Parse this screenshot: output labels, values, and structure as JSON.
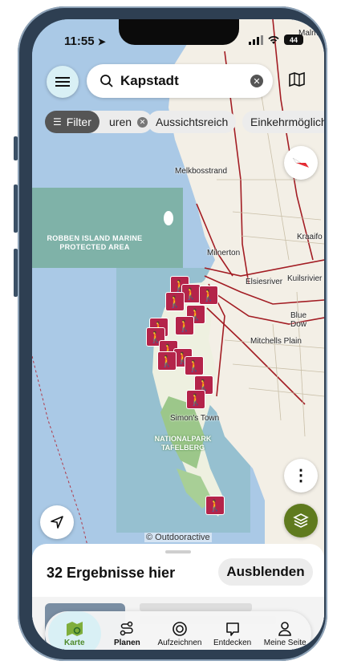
{
  "status_bar": {
    "time": "11:55",
    "battery": "44"
  },
  "search": {
    "query": "Kapstadt"
  },
  "filter_chips": [
    {
      "label": "Filter"
    },
    {
      "label": "uren"
    },
    {
      "label": "Aussichtsreich"
    },
    {
      "label": "Einkehrmöglich"
    }
  ],
  "map": {
    "labels": {
      "melkbosstrand": "Melkbosstrand",
      "malm": "Malm",
      "kraaifo": "Kraaifo",
      "milnerton": "Milnerton",
      "elsiesriver": "Elsiesriver",
      "kuilsrivier": "Kuilsrivier",
      "blue_down": "Blue Dow",
      "mitchells_plain": "Mitchells Plain",
      "simons_town": "Simon's Town",
      "robben_island_1": "ROBBEN ISLAND MARINE",
      "robben_island_2": "PROTECTED AREA",
      "nationalpark_1": "NATIONALPARK",
      "nationalpark_2": "TAFELBERG"
    },
    "copyright": "© Outdooractive"
  },
  "sheet": {
    "results_count": "32 Ergebnisse hier",
    "hide_label": "Ausblenden"
  },
  "tabbar": {
    "tabs": [
      {
        "label": "Karte"
      },
      {
        "label": "Planen"
      },
      {
        "label": "Aufzeichnen"
      },
      {
        "label": "Entdecken"
      },
      {
        "label": "Meine Seite"
      }
    ]
  },
  "colors": {
    "water": "#aac9e6",
    "land": "#f3efe6",
    "protected_area": "#7fb2a8",
    "pin": "#b4244a",
    "road": "#a31d24",
    "layers_button": "#5f7a1e",
    "active_tab": "#d9f0f5"
  }
}
